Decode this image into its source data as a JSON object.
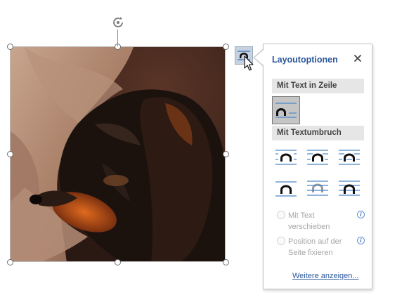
{
  "document": {
    "picture": {
      "description_icon": "sleeping-dog-photo"
    },
    "rotate_handle_icon": "rotate-icon"
  },
  "layout_button": {
    "icon": "wrap-options-icon"
  },
  "panel": {
    "title": "Layoutoptionen",
    "close_icon": "close-icon",
    "section_inline": "Mit Text in Zeile",
    "section_wrap": "Mit Textumbruch",
    "wrap_options": [
      {
        "icon": "wrap-square-icon"
      },
      {
        "icon": "wrap-tight-icon"
      },
      {
        "icon": "wrap-through-icon"
      },
      {
        "icon": "wrap-top-bottom-icon"
      },
      {
        "icon": "wrap-behind-text-icon"
      },
      {
        "icon": "wrap-in-front-icon"
      }
    ],
    "radio_move": {
      "label": "Mit Text verschieben",
      "checked": false,
      "enabled": false
    },
    "radio_fixed": {
      "label": "Position auf der Seite fixieren",
      "checked": false,
      "enabled": false
    },
    "more_link": "Weitere anzeigen..."
  },
  "colors": {
    "accent": "#2b579a",
    "icon_lines": "#4a86c8"
  }
}
